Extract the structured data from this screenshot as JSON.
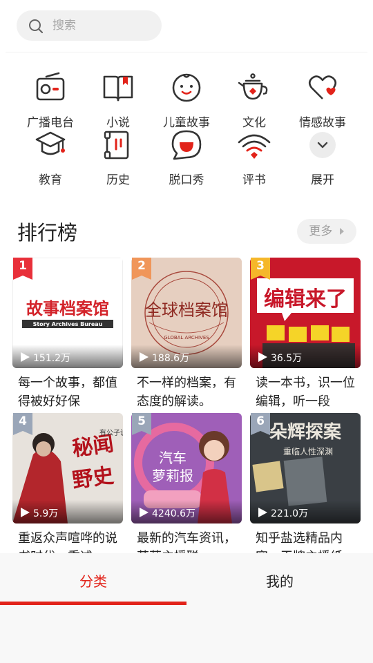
{
  "search": {
    "placeholder": "搜索"
  },
  "categories": [
    {
      "label": "广播电台",
      "icon": "radio-icon"
    },
    {
      "label": "小说",
      "icon": "book-icon"
    },
    {
      "label": "儿童故事",
      "icon": "child-face-icon"
    },
    {
      "label": "文化",
      "icon": "teapot-icon"
    },
    {
      "label": "情感故事",
      "icon": "heart-icon"
    },
    {
      "label": "教育",
      "icon": "graduation-cap-icon"
    },
    {
      "label": "历史",
      "icon": "scroll-icon"
    },
    {
      "label": "脱口秀",
      "icon": "speech-bubble-icon"
    },
    {
      "label": "评书",
      "icon": "fan-icon"
    },
    {
      "label": "展开",
      "icon": "chevron-down-icon"
    }
  ],
  "ranking": {
    "title": "排行榜",
    "more_label": "更多",
    "items": [
      {
        "rank": "1",
        "plays": "151.2万",
        "desc": "每一个故事，都值得被好好保",
        "cover_text": "故事档案馆",
        "cover_subtext": "Story Archives Bureau"
      },
      {
        "rank": "2",
        "plays": "188.6万",
        "desc": "不一样的档案，有态度的解读。",
        "cover_text": "全球档案馆",
        "cover_subtext": "GLOBAL ARCHIVES"
      },
      {
        "rank": "3",
        "plays": "36.5万",
        "desc": "读一本书，识一位编辑，听一段",
        "cover_text": "编辑来了",
        "cover_subtext": ""
      },
      {
        "rank": "4",
        "plays": "5.9万",
        "desc": "重返众声喧哗的说书时代，重述",
        "cover_text": "秘闻野史",
        "cover_subtext": "有公子说"
      },
      {
        "rank": "5",
        "plays": "4240.6万",
        "desc": "最新的汽车资讯，萝莉主播联",
        "cover_text": "汽车萝莉报",
        "cover_subtext": ""
      },
      {
        "rank": "6",
        "plays": "221.0万",
        "desc": "知乎盐选精品内容，王牌主播纸",
        "cover_text": "朵辉探案",
        "cover_subtext": "重临人性深渊"
      }
    ]
  },
  "colors": {
    "accent": "#e2231a",
    "badge_1": "#e8303a",
    "badge_2": "#f0965a",
    "badge_3": "#f5b72a",
    "badge_other": "#9aa6b8"
  },
  "tabs": [
    {
      "label": "分类",
      "active": true
    },
    {
      "label": "我的",
      "active": false
    }
  ]
}
